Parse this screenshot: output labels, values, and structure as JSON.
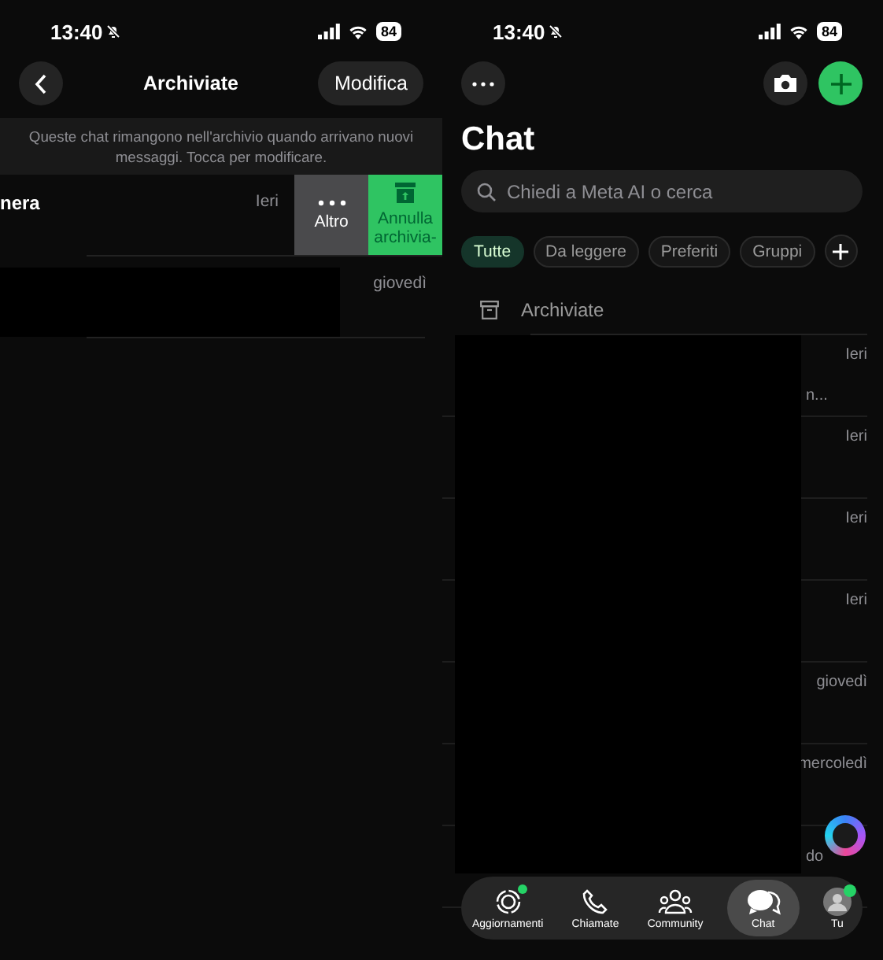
{
  "left": {
    "status": {
      "time": "13:40",
      "battery": "84",
      "muted": true
    },
    "header": {
      "title": "Archiviate",
      "edit_button": "Modifica"
    },
    "banner": "Queste chat rimangono nell'archivio quando arrivano nuovi messaggi. Tocca per modificare.",
    "rows": [
      {
        "name": "nera",
        "time": "Ieri",
        "redacted": false,
        "actions": [
          {
            "kind": "more",
            "label": "Altro"
          },
          {
            "kind": "unarchive",
            "label": "Annulla archivia-"
          }
        ]
      },
      {
        "time": "giovedì",
        "redacted": true
      }
    ]
  },
  "right": {
    "status": {
      "time": "13:40",
      "battery": "84",
      "muted": true
    },
    "title": "Chat",
    "search": {
      "placeholder": "Chiedi a Meta AI o cerca"
    },
    "filters": [
      {
        "label": "Tutte",
        "selected": true
      },
      {
        "label": "Da leggere",
        "selected": false
      },
      {
        "label": "Preferiti",
        "selected": false
      },
      {
        "label": "Gruppi",
        "selected": false
      }
    ],
    "archived": {
      "label": "Archiviate"
    },
    "chats": [
      {
        "time": "Ieri",
        "snippet": "n..."
      },
      {
        "time": "Ieri"
      },
      {
        "time": "Ieri"
      },
      {
        "time": "Ieri"
      },
      {
        "time": "giovedì"
      },
      {
        "time": "mercoledì"
      },
      {
        "snippet": "do"
      }
    ],
    "tabs": [
      {
        "kind": "updates",
        "label": "Aggiornamenti",
        "selected": false,
        "badge": true
      },
      {
        "kind": "calls",
        "label": "Chiamate",
        "selected": false,
        "badge": false
      },
      {
        "kind": "communities",
        "label": "Community",
        "selected": false,
        "badge": false
      },
      {
        "kind": "chats",
        "label": "Chat",
        "selected": true,
        "badge": false
      },
      {
        "kind": "profile",
        "label": "Tu",
        "selected": false,
        "badge": true
      }
    ]
  }
}
